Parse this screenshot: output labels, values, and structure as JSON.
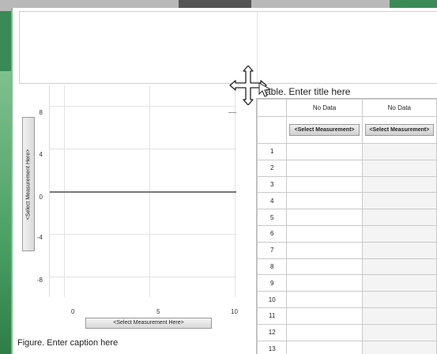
{
  "title_placeholder": "",
  "graph": {
    "y_axis_label": "<Select Measurement Here>",
    "x_axis_label": "<Select Measurement Here>",
    "y_ticks": [
      "8",
      "4",
      "0",
      "-4",
      "-8"
    ],
    "x_ticks": [
      "0",
      "5",
      "10"
    ],
    "caption": "Figure. Enter caption here"
  },
  "chart_data": {
    "type": "line",
    "series": [],
    "xlim": [
      0,
      10
    ],
    "ylim": [
      -10,
      10
    ],
    "xlabel": "<Select Measurement Here>",
    "ylabel": "<Select Measurement Here>",
    "grid": true
  },
  "table": {
    "title": "Table. Enter title here",
    "columns": [
      {
        "name": "No Data",
        "measurement": "<Select Measurement>"
      },
      {
        "name": "No Data",
        "measurement": "<Select Measurement>"
      }
    ],
    "rows": [
      "1",
      "2",
      "3",
      "4",
      "5",
      "6",
      "7",
      "8",
      "9",
      "10",
      "11",
      "12",
      "13"
    ]
  },
  "cursor_icon": "move-cursor-icon"
}
